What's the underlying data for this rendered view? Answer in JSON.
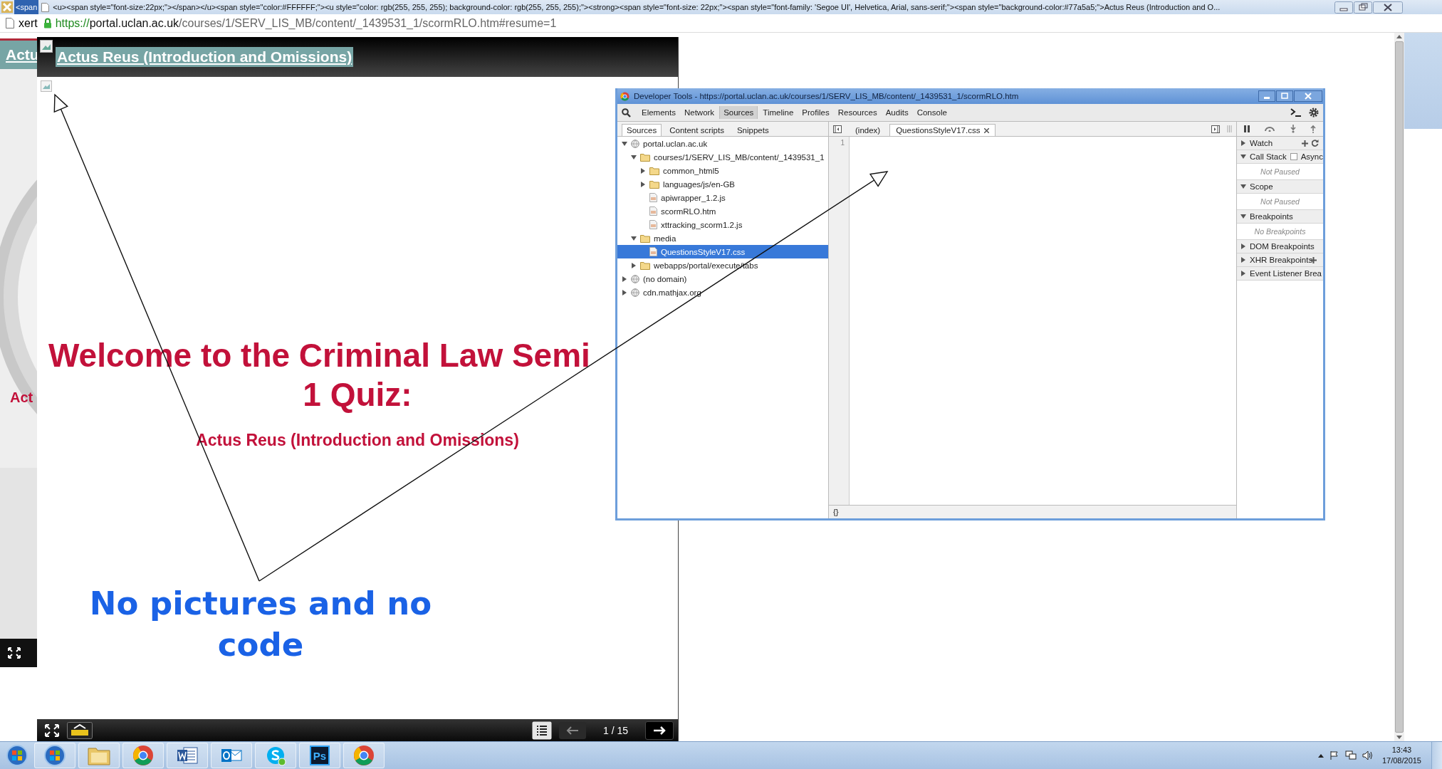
{
  "browser": {
    "tab_text": "<span",
    "title": "<u><span style=\"font-size:22px;\"></span></u><span style=\"color:#FFFFFF;\"><u style=\"color: rgb(255, 255, 255); background-color: rgb(255, 255, 255);\"><strong><span style=\"font-size: 22px;\"><span style=\"font-family: 'Segoe UI', Helvetica, Arial, sans-serif;\"><span style=\"background-color:#77a5a5;\">Actus Reus (Introduction and O...",
    "address_prefix": "xert",
    "url": {
      "scheme": "https://",
      "host": "portal.uclan.ac.uk",
      "path": "/courses/1/SERV_LIS_MB/content/_1439531_1/scormRLO.htm#resume=1"
    }
  },
  "background_slide": {
    "title": "Actu",
    "text": "Act"
  },
  "player": {
    "title": "Actus Reus (Introduction and Omissions)",
    "heading_lines": [
      "Welcome to the Criminal Law Semi",
      "1 Quiz:"
    ],
    "subtitle": "Actus Reus (Introduction and Omissions)",
    "page": "1 / 15"
  },
  "annotation": {
    "lines": [
      "No pictures and no",
      "code"
    ]
  },
  "devtools": {
    "title": "Developer Tools - https://portal.uclan.ac.uk/courses/1/SERV_LIS_MB/content/_1439531_1/scormRLO.htm",
    "tabs": [
      {
        "label": "Elements",
        "selected": false
      },
      {
        "label": "Network",
        "selected": false
      },
      {
        "label": "Sources",
        "selected": true
      },
      {
        "label": "Timeline",
        "selected": false
      },
      {
        "label": "Profiles",
        "selected": false
      },
      {
        "label": "Resources",
        "selected": false
      },
      {
        "label": "Audits",
        "selected": false
      },
      {
        "label": "Console",
        "selected": false
      }
    ],
    "navigator_tabs": [
      {
        "label": "Sources",
        "selected": true
      },
      {
        "label": "Content scripts",
        "selected": false
      },
      {
        "label": "Snippets",
        "selected": false
      }
    ],
    "tree": [
      {
        "label": "portal.uclan.ac.uk",
        "kind": "domain",
        "expanded": true,
        "selected": false,
        "children": [
          {
            "label": "courses/1/SERV_LIS_MB/content/_1439531_1",
            "kind": "folder",
            "expanded": true,
            "selected": false,
            "children": [
              {
                "label": "common_html5",
                "kind": "folder",
                "expanded": false,
                "selected": false
              },
              {
                "label": "languages/js/en-GB",
                "kind": "folder",
                "expanded": false,
                "selected": false
              },
              {
                "label": "apiwrapper_1.2.js",
                "kind": "file",
                "selected": false
              },
              {
                "label": "scormRLO.htm",
                "kind": "file",
                "selected": false
              },
              {
                "label": "xttracking_scorm1.2.js",
                "kind": "file",
                "selected": false
              }
            ]
          },
          {
            "label": "media",
            "kind": "folder",
            "expanded": true,
            "selected": false,
            "children": [
              {
                "label": "QuestionsStyleV17.css",
                "kind": "file",
                "selected": true
              }
            ]
          },
          {
            "label": "webapps/portal/execute/tabs",
            "kind": "folder",
            "expanded": false,
            "selected": false
          }
        ]
      },
      {
        "label": "(no domain)",
        "kind": "domain",
        "expanded": false,
        "selected": false
      },
      {
        "label": "cdn.mathjax.org",
        "kind": "domain",
        "expanded": false,
        "selected": false
      }
    ],
    "editor_tabs": [
      {
        "label": "(index)",
        "selected": false
      },
      {
        "label": "QuestionsStyleV17.css",
        "selected": true
      }
    ],
    "line_numbers": [
      "1"
    ],
    "format_button": "{}",
    "sections": [
      {
        "label": "Watch",
        "kind": "watch",
        "expanded": false
      },
      {
        "label": "Call Stack",
        "kind": "callstack",
        "expanded": true,
        "async": {
          "label": "Async",
          "checked": false
        },
        "message": "Not Paused"
      },
      {
        "label": "Scope",
        "kind": "plain",
        "expanded": true,
        "message": "Not Paused"
      },
      {
        "label": "Breakpoints",
        "kind": "plain",
        "expanded": true,
        "message": "No Breakpoints"
      },
      {
        "label": "DOM Breakpoints",
        "kind": "plain",
        "expanded": false
      },
      {
        "label": "XHR Breakpoints",
        "kind": "xhr",
        "expanded": false
      },
      {
        "label": "Event Listener Brea",
        "kind": "plain",
        "expanded": false
      }
    ]
  },
  "taskbar": {
    "apps": [
      {
        "kind": "orb"
      },
      {
        "kind": "explorer"
      },
      {
        "kind": "chrome"
      },
      {
        "kind": "word"
      },
      {
        "kind": "outlook"
      },
      {
        "kind": "skype"
      },
      {
        "kind": "photoshop",
        "label": "Ps"
      },
      {
        "kind": "chrome"
      }
    ],
    "time": "13:43",
    "date": "17/08/2015"
  }
}
